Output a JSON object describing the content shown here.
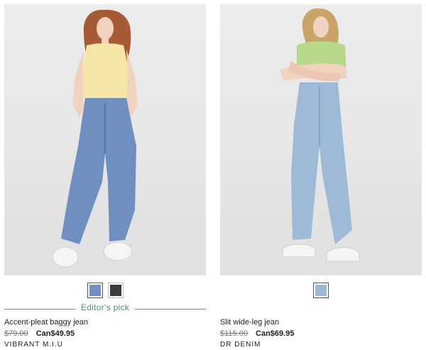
{
  "products": [
    {
      "name": "Accent-pleat baggy jean",
      "badge": "Editor's pick",
      "old_price": "$79.00",
      "new_price": "Can$49.95",
      "brand": "VIBRANT M.I.U",
      "swatches": [
        {
          "color": "#6f8fc4",
          "selected": true
        },
        {
          "color": "#3c3c3c",
          "selected": false
        }
      ]
    },
    {
      "name": "Slit wide-leg jean",
      "old_price": "$115.00",
      "new_price": "Can$69.95",
      "brand": "DR DENIM",
      "swatches": [
        {
          "color": "#9cb8d8",
          "selected": true
        }
      ]
    }
  ],
  "colors": {
    "badge": "#4f8f79",
    "denim_mid": "#6e8fc0",
    "denim_light": "#9fbad8",
    "top_yellow": "#f4e7a6",
    "top_green": "#b8d88c"
  }
}
